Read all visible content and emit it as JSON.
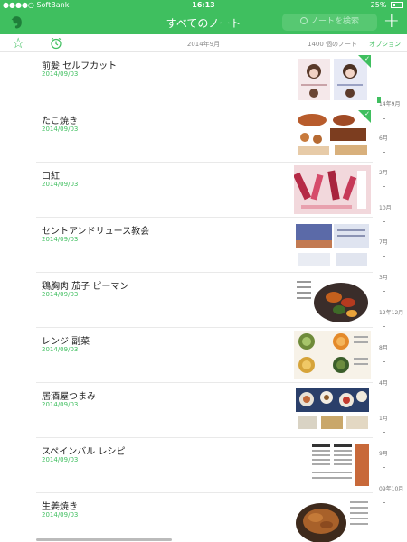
{
  "status": {
    "carrier": "●●●●○ SoftBank",
    "time": "16:13",
    "battery": "25%"
  },
  "nav": {
    "title": "すべてのノート",
    "search_placeholder": "ノートを検索",
    "add": "+"
  },
  "subbar": {
    "month": "2014年9月",
    "count": "1400 個のノート",
    "options": "オプション"
  },
  "notes": [
    {
      "title": "前髪 セルフカット",
      "date": "2014/09/03",
      "thumb": "hair-cut-page"
    },
    {
      "title": "たこ焼き",
      "date": "2014/09/03",
      "thumb": "takoyaki-page"
    },
    {
      "title": "口紅",
      "date": "2014/09/03",
      "thumb": "lipstick-page"
    },
    {
      "title": "セントアンドリュース教会",
      "date": "2014/09/03",
      "thumb": "church-page"
    },
    {
      "title": "鶏胸肉 茄子 ピーマン",
      "date": "2014/09/03",
      "thumb": "chicken-eggplant-page"
    },
    {
      "title": "レンジ 副菜",
      "date": "2014/09/03",
      "thumb": "side-dish-page"
    },
    {
      "title": "居酒屋つまみ",
      "date": "2014/09/03",
      "thumb": "izakaya-page"
    },
    {
      "title": "スペインバル レシピ",
      "date": "2014/09/03",
      "thumb": "spain-bar-page"
    },
    {
      "title": "生姜焼き",
      "date": "2014/09/03",
      "thumb": "ginger-pork-page"
    }
  ],
  "timeline": [
    "14年9月",
    "6月",
    "2月",
    "10月",
    "7月",
    "3月",
    "12年12月",
    "8月",
    "4月",
    "1月",
    "9月",
    "09年10月"
  ]
}
